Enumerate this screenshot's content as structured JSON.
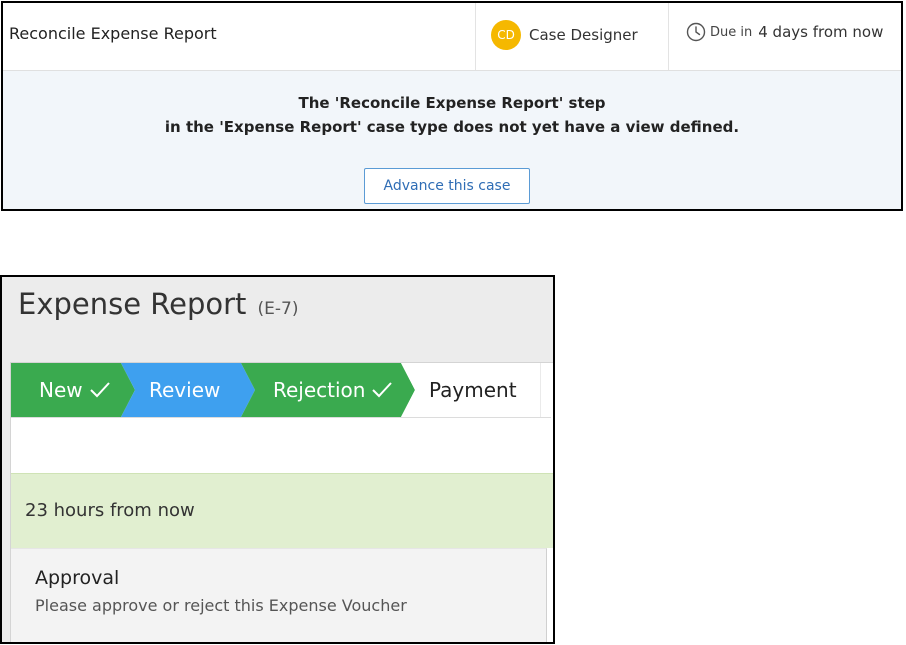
{
  "task_panel": {
    "title": "Reconcile Expense Report",
    "assignee": {
      "initials": "CD",
      "name": "Case Designer",
      "avatar_color": "#f5b800"
    },
    "due": {
      "icon": "clock-icon",
      "prefix": "Due in",
      "value": "4 days from now"
    },
    "message_line1": "The 'Reconcile Expense Report' step",
    "message_line2": "in the 'Expense Report' case type does not yet have a view defined.",
    "advance_button": "Advance this case"
  },
  "case_panel": {
    "title": "Expense Report",
    "case_id": "(E-7)",
    "stages": [
      {
        "label": "New",
        "status": "completed",
        "color": "#3aaa4f"
      },
      {
        "label": "Review",
        "status": "current",
        "color": "#3ea0ef"
      },
      {
        "label": "Rejection",
        "status": "completed",
        "color": "#3aaa4f"
      },
      {
        "label": "Payment",
        "status": "pending",
        "color": "#ffffff"
      }
    ],
    "sla_text": "23 hours from now",
    "assignment": {
      "title": "Approval",
      "instructions": "Please approve or reject this Expense Voucher"
    }
  }
}
